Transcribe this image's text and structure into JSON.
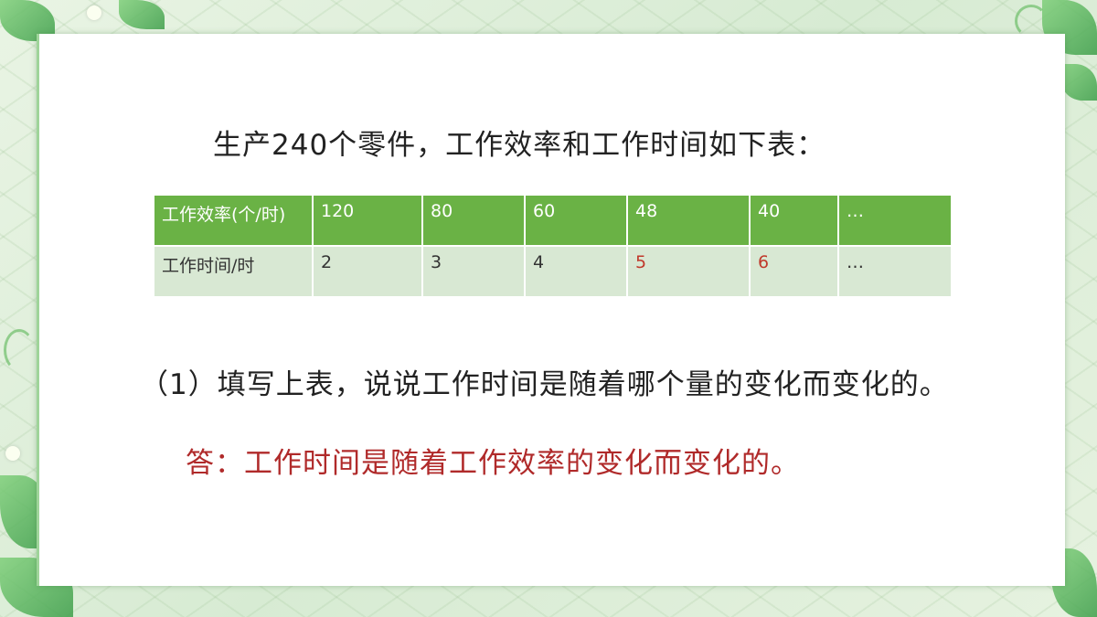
{
  "intro": "生产240个零件，工作效率和工作时间如下表：",
  "table": {
    "row1": {
      "header": "工作效率(个/时)",
      "cells": [
        "120",
        "80",
        "60",
        "48",
        "40",
        "…"
      ]
    },
    "row2": {
      "header": "工作时间/时",
      "cells": [
        "2",
        "3",
        "4",
        "5",
        "6",
        "…"
      ]
    }
  },
  "question": "（1）填写上表，说说工作时间是随着哪个量的变化而变化的。",
  "answer": "答：工作时间是随着工作效率的变化而变化的。",
  "colors": {
    "header_green": "#6ab245",
    "body_green": "#d8e8d3",
    "answer_red": "#b02a2a"
  }
}
